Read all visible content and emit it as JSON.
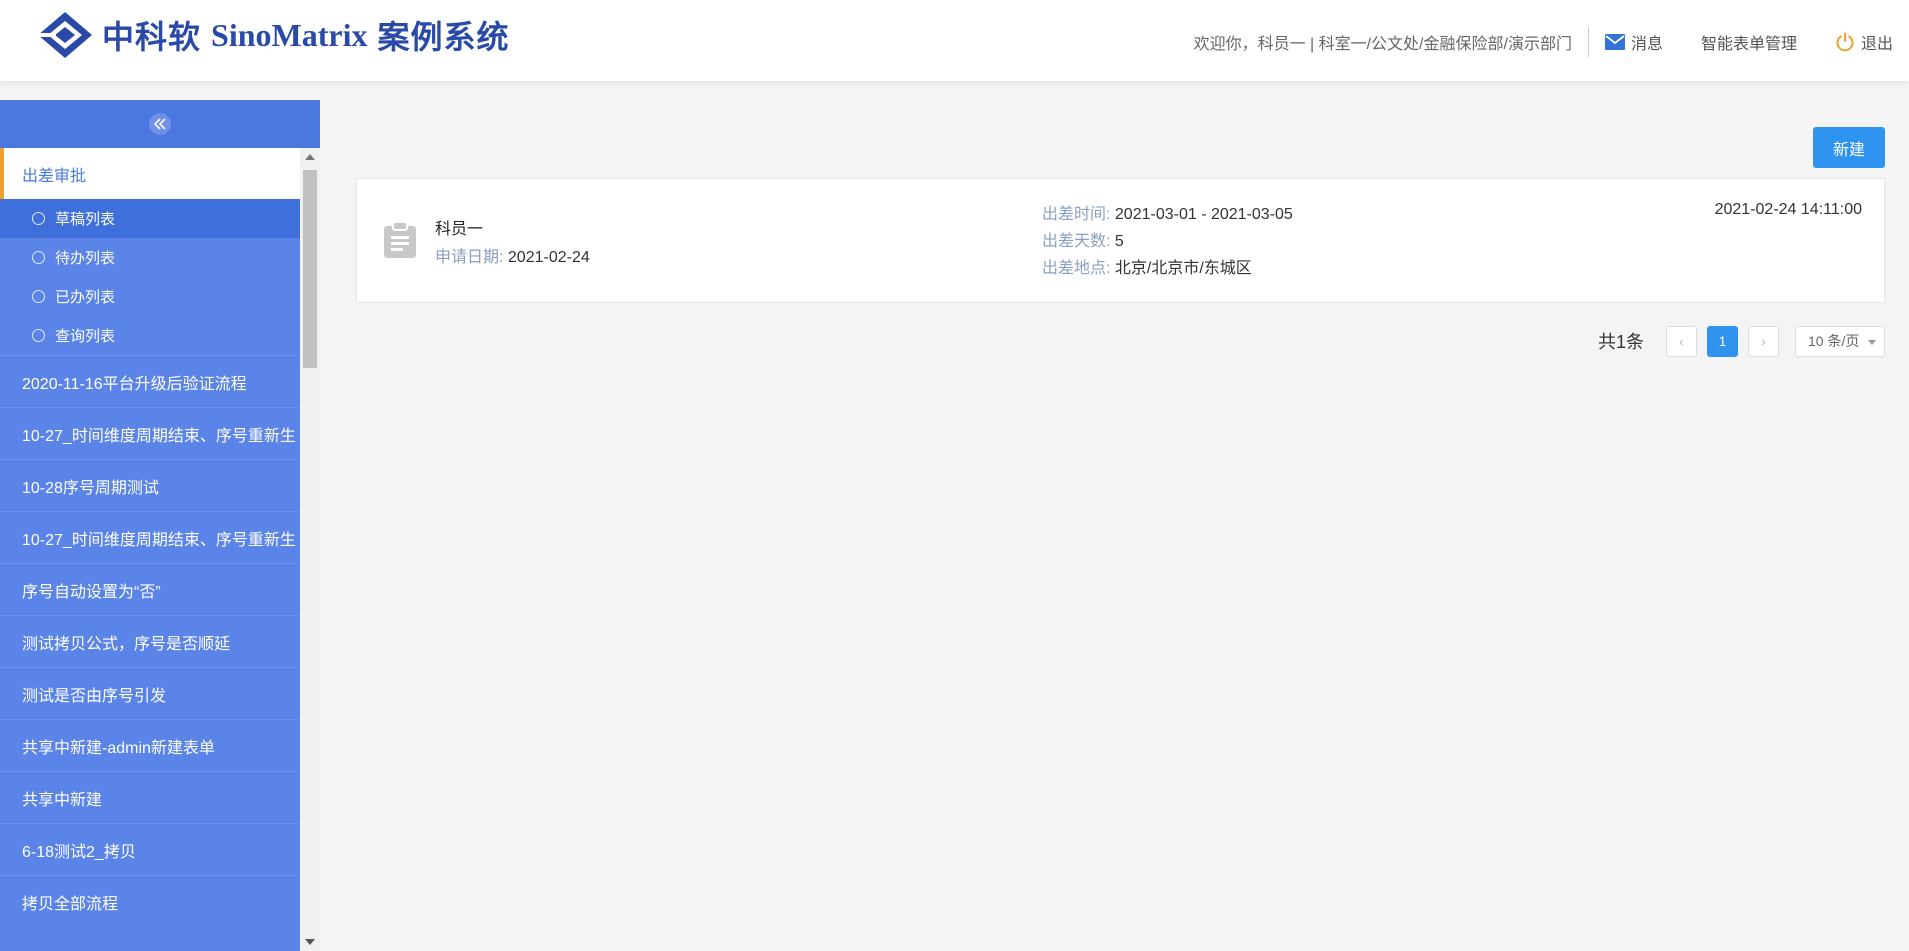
{
  "header": {
    "logo_cn": "中科软",
    "logo_en": "SinoMatrix",
    "logo_suffix": "案例系统",
    "welcome": "欢迎你，科员一 | 科室一/公文处/金融保险部/演示部门",
    "messages_label": "消息",
    "form_manage_label": "智能表单管理",
    "logout_label": "退出"
  },
  "sidebar": {
    "active_item": "出差审批",
    "sub_items": [
      {
        "label": "草稿列表",
        "selected": true
      },
      {
        "label": "待办列表",
        "selected": false
      },
      {
        "label": "已办列表",
        "selected": false
      },
      {
        "label": "查询列表",
        "selected": false
      }
    ],
    "items": [
      "2020-11-16平台升级后验证流程",
      "10-27_时间维度周期结束、序号重新生",
      "10-28序号周期测试",
      "10-27_时间维度周期结束、序号重新生",
      "序号自动设置为“否”",
      "测试拷贝公式，序号是否顺延",
      "测试是否由序号引发",
      "共享中新建-admin新建表单",
      "共享中新建",
      "6-18测试2_拷贝",
      "拷贝全部流程"
    ]
  },
  "toolbar": {
    "new_label": "新建"
  },
  "card": {
    "name": "科员一",
    "apply_date_label": "申请日期:",
    "apply_date": "2021-02-24",
    "trip_time_label": "出差时间:",
    "trip_time": "2021-03-01 - 2021-03-05",
    "trip_days_label": "出差天数:",
    "trip_days": "5",
    "trip_place_label": "出差地点:",
    "trip_place": "北京/北京市/东城区",
    "timestamp": "2021-02-24 14:11:00"
  },
  "pagination": {
    "total": "共1条",
    "prev": "‹",
    "current": "1",
    "next": "›",
    "page_size": "10 条/页"
  },
  "colors": {
    "brand": "#2a4aa8",
    "sidebar": "#5a84e8",
    "primary": "#2f94ef",
    "active_border": "#f0a030"
  }
}
